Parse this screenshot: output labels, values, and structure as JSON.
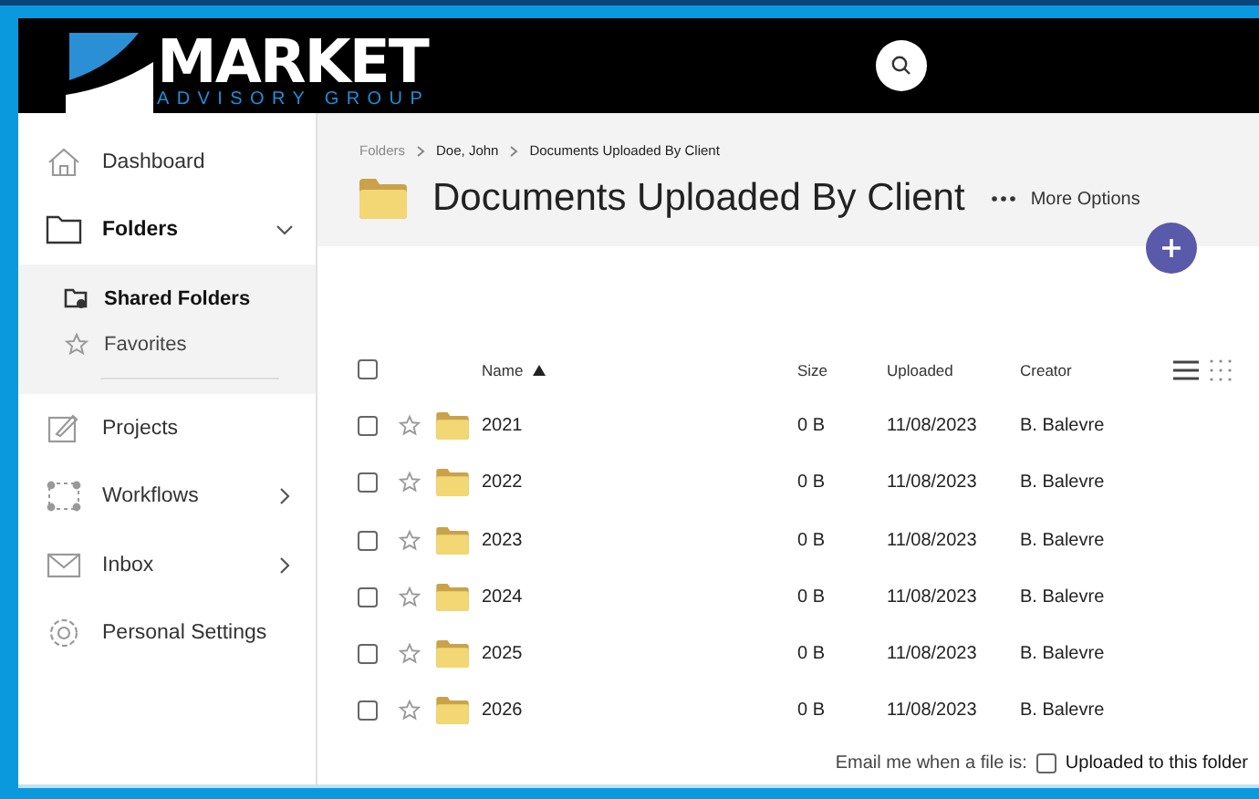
{
  "logo": {
    "name": "MARKET",
    "tagline": "ADVISORY GROUP"
  },
  "sidebar": {
    "items": [
      {
        "label": "Dashboard"
      },
      {
        "label": "Folders",
        "expanded": true,
        "children": [
          {
            "label": "Shared Folders",
            "selected": true
          },
          {
            "label": "Favorites",
            "selected": false
          }
        ]
      },
      {
        "label": "Projects"
      },
      {
        "label": "Workflows",
        "expanded": false
      },
      {
        "label": "Inbox",
        "expanded": false
      },
      {
        "label": "Personal Settings"
      }
    ]
  },
  "breadcrumb": [
    "Folders",
    "Doe, John",
    "Documents Uploaded By Client"
  ],
  "title": "Documents Uploaded By Client",
  "more_options": "More Options",
  "table": {
    "columns": [
      "Name",
      "Size",
      "Uploaded",
      "Creator"
    ],
    "header_checked": false,
    "rows": [
      {
        "name": "2021",
        "size": "0 B",
        "uploaded": "11/08/2023",
        "creator": "B. Balevre",
        "checked": false,
        "starred": false
      },
      {
        "name": "2022",
        "size": "0 B",
        "uploaded": "11/08/2023",
        "creator": "B. Balevre",
        "checked": false,
        "starred": false
      },
      {
        "name": "2023",
        "size": "0 B",
        "uploaded": "11/08/2023",
        "creator": "B. Balevre",
        "checked": false,
        "starred": false
      },
      {
        "name": "2024",
        "size": "0 B",
        "uploaded": "11/08/2023",
        "creator": "B. Balevre",
        "checked": false,
        "starred": false
      },
      {
        "name": "2025",
        "size": "0 B",
        "uploaded": "11/08/2023",
        "creator": "B. Balevre",
        "checked": false,
        "starred": false
      },
      {
        "name": "2026",
        "size": "0 B",
        "uploaded": "11/08/2023",
        "creator": "B. Balevre",
        "checked": false,
        "starred": false
      }
    ]
  },
  "notify": {
    "label": "Email me when a file is:",
    "option": "Uploaded to this folder",
    "checked": false
  }
}
